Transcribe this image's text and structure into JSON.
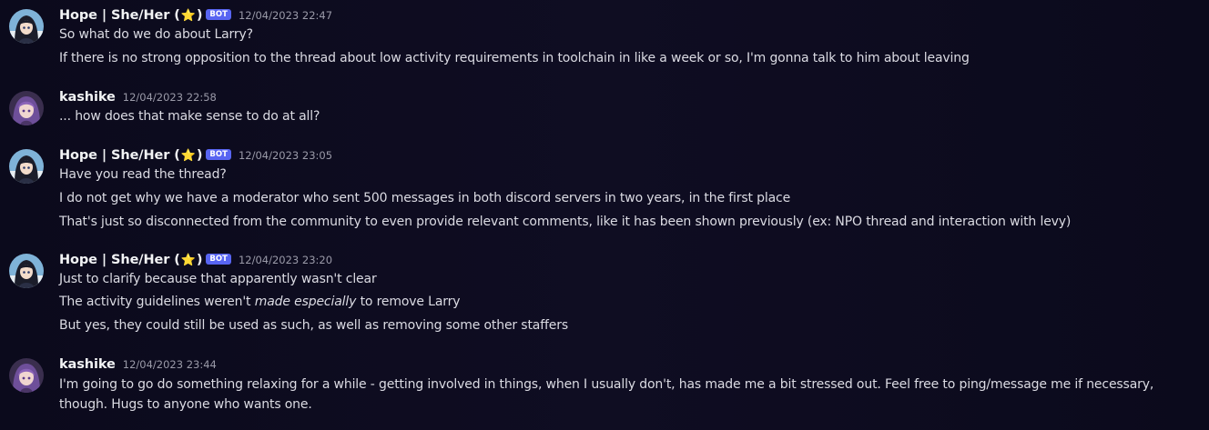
{
  "messages": [
    {
      "author": "Hope | She/Her (",
      "author_suffix": ")",
      "star": "⭐",
      "bot_label": "BOT",
      "timestamp": "12/04/2023 22:47",
      "lines": [
        "So what do we do about Larry?",
        "If there is no strong opposition to the thread about low activity requirements in toolchain in like a week or so, I'm gonna talk to him about leaving"
      ]
    },
    {
      "author": "kashike",
      "timestamp": "12/04/2023 22:58",
      "lines": [
        "... how does that make sense to do at all?"
      ]
    },
    {
      "author": "Hope | She/Her (",
      "author_suffix": ")",
      "star": "⭐",
      "bot_label": "BOT",
      "timestamp": "12/04/2023 23:05",
      "lines": [
        "Have you read the thread?",
        "I do not get why we have a moderator who sent 500 messages in both discord servers in two years, in the first place",
        "That's just so disconnected from the community to even provide relevant comments, like it has been shown previously (ex: NPO thread and interaction with levy)"
      ]
    },
    {
      "author": "Hope | She/Her (",
      "author_suffix": ")",
      "star": "⭐",
      "bot_label": "BOT",
      "timestamp": "12/04/2023 23:20",
      "lines": [
        "Just to clarify because that apparently wasn't clear",
        {
          "before": "The activity guidelines weren't ",
          "emphasis": "made especially",
          "after": " to remove Larry"
        },
        "But yes, they could still be used as such, as well as removing some other staffers"
      ]
    },
    {
      "author": "kashike",
      "timestamp": "12/04/2023 23:44",
      "lines": [
        "I'm going to go do something relaxing for a while - getting involved in things, when I usually don't, has made me a bit stressed out. Feel free to ping/message me if necessary, though. Hugs to anyone who wants one."
      ]
    }
  ],
  "colors": {
    "background": "#0d0c20",
    "bot_tag": "#5865f2",
    "username": "#f2f3f5",
    "timestamp": "#9a9aa8",
    "text": "#dbdbe3",
    "star": "#f5c518"
  },
  "icons": {
    "avatar_hope": "anime-girl-avatar",
    "avatar_kashike": "purple-hair-avatar",
    "star": "star-emoji"
  }
}
